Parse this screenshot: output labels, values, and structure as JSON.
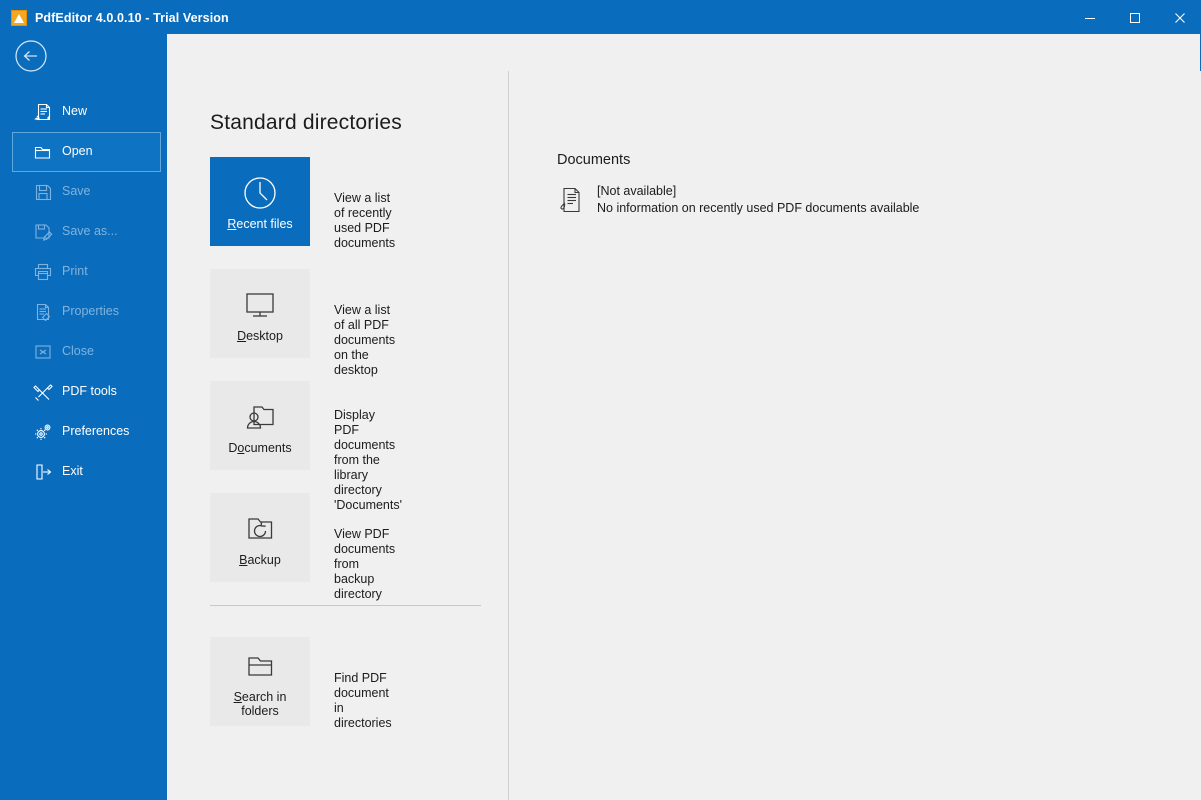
{
  "window": {
    "title": "PdfEditor 4.0.0.10 - Trial Version",
    "app_icon": "pdf-app-icon",
    "controls": {
      "minimize": "minimize-icon",
      "maximize": "maximize-icon",
      "close": "close-icon"
    },
    "accent_color": "#0a6cbd",
    "content_background": "#f0f0f0",
    "tile_background": "#e9e9e9"
  },
  "sidebar": {
    "back_label": "Back",
    "items": [
      {
        "label": "New",
        "icon": "new-document-icon",
        "enabled": true,
        "selected": false
      },
      {
        "label": "Open",
        "icon": "open-folder-icon",
        "enabled": true,
        "selected": true
      },
      {
        "label": "Save",
        "icon": "save-floppy-icon",
        "enabled": false,
        "selected": false
      },
      {
        "label": "Save as...",
        "icon": "save-as-icon",
        "enabled": false,
        "selected": false
      },
      {
        "label": "Print",
        "icon": "printer-icon",
        "enabled": false,
        "selected": false
      },
      {
        "label": "Properties",
        "icon": "properties-icon",
        "enabled": false,
        "selected": false
      },
      {
        "label": "Close",
        "icon": "close-box-icon",
        "enabled": false,
        "selected": false
      },
      {
        "label": "PDF tools",
        "icon": "tools-icon",
        "enabled": true,
        "selected": false
      },
      {
        "label": "Preferences",
        "icon": "gear-icon",
        "enabled": true,
        "selected": false
      },
      {
        "label": "Exit",
        "icon": "exit-door-icon",
        "enabled": true,
        "selected": false
      }
    ]
  },
  "main": {
    "panel_title": "Standard directories",
    "tiles": [
      {
        "label_pre": "",
        "label_accel": "R",
        "label_post": "ecent files",
        "icon": "clock-icon",
        "description": "View a list of recently used PDF documents",
        "selected": true
      },
      {
        "label_pre": "",
        "label_accel": "D",
        "label_post": "esktop",
        "icon": "monitor-icon",
        "description": "View a list of all PDF documents on the desktop",
        "selected": false
      },
      {
        "label_pre": "D",
        "label_accel": "o",
        "label_post": "cuments",
        "icon": "folder-user-icon",
        "description": "Display PDF documents from the library directory 'Documents'",
        "selected": false
      },
      {
        "label_pre": "",
        "label_accel": "B",
        "label_post": "ackup",
        "icon": "folder-restore-icon",
        "description": "View PDF documents from backup directory",
        "selected": false
      },
      {
        "label_pre": "",
        "label_accel": "S",
        "label_post": "earch in folders",
        "icon": "folder-open-icon",
        "description": "Find PDF document in directories",
        "selected": false
      }
    ]
  },
  "details": {
    "title": "Documents",
    "entry": {
      "icon": "pdf-document-icon",
      "name": "[Not available]",
      "subtitle": "No information on recently used PDF documents available"
    }
  }
}
